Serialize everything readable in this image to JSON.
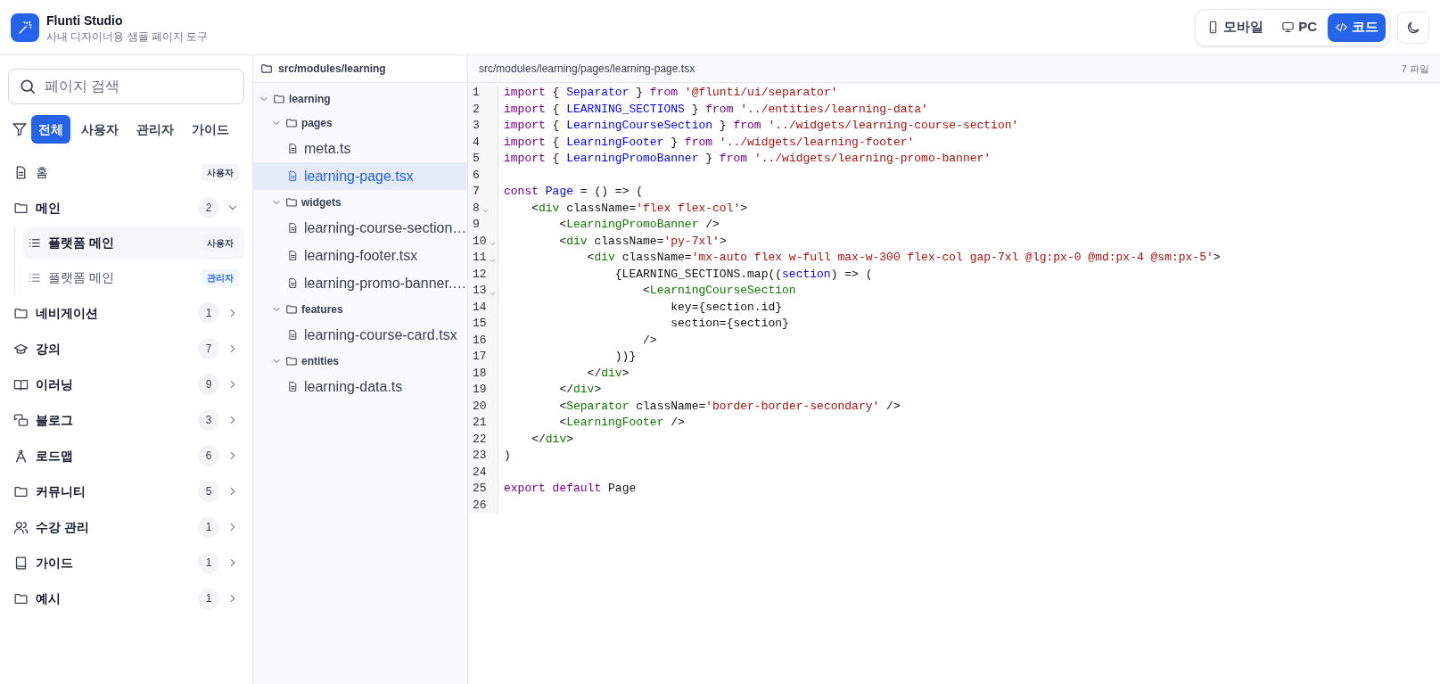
{
  "app": {
    "title": "Flunti Studio",
    "subtitle": "사내 디자이너용 샘플 페이지 도구"
  },
  "view_toggle": [
    {
      "label": "모바일",
      "selected": false
    },
    {
      "label": "PC",
      "selected": false
    },
    {
      "label": "코드",
      "selected": true
    }
  ],
  "sidebar": {
    "search": {
      "placeholder": "페이지 검색"
    },
    "filters": [
      {
        "label": "전체",
        "selected": true
      },
      {
        "label": "사용자",
        "selected": false
      },
      {
        "label": "관리자",
        "selected": false
      },
      {
        "label": "가이드",
        "selected": false
      }
    ],
    "items": [
      {
        "label": "홈",
        "badge": {
          "text": "사용자",
          "kind": "user"
        }
      },
      {
        "label": "메인",
        "count": "2",
        "expanded": true,
        "children": [
          {
            "label": "플랫폼 메인",
            "selected": true,
            "badge": {
              "text": "사용자",
              "kind": "user"
            }
          },
          {
            "label": "플랫폼 메인",
            "selected": false,
            "badge": {
              "text": "관리자",
              "kind": "admin"
            }
          }
        ]
      },
      {
        "label": "네비게이션",
        "count": "1",
        "expanded": false
      },
      {
        "label": "강의",
        "count": "7",
        "expanded": false
      },
      {
        "label": "이러닝",
        "count": "9",
        "expanded": false
      },
      {
        "label": "블로그",
        "count": "3",
        "expanded": false
      },
      {
        "label": "로드맵",
        "count": "6",
        "expanded": false
      },
      {
        "label": "커뮤니티",
        "count": "5",
        "expanded": false
      },
      {
        "label": "수강 관리",
        "count": "1",
        "expanded": false
      },
      {
        "label": "가이드",
        "count": "1",
        "expanded": false
      },
      {
        "label": "예시",
        "count": "1",
        "expanded": false
      }
    ]
  },
  "file_tree": {
    "root": "src/modules/learning",
    "nodes": [
      {
        "kind": "folder",
        "label": "learning",
        "expanded": true,
        "children": [
          {
            "kind": "folder",
            "label": "pages",
            "expanded": true,
            "children": [
              {
                "kind": "file",
                "label": "meta.ts",
                "selected": false
              },
              {
                "kind": "file",
                "label": "learning-page.tsx",
                "selected": true
              }
            ]
          },
          {
            "kind": "folder",
            "label": "widgets",
            "expanded": true,
            "children": [
              {
                "kind": "file",
                "label": "learning-course-section…",
                "selected": false
              },
              {
                "kind": "file",
                "label": "learning-footer.tsx",
                "selected": false
              },
              {
                "kind": "file",
                "label": "learning-promo-banner.…",
                "selected": false
              }
            ]
          },
          {
            "kind": "folder",
            "label": "features",
            "expanded": true,
            "children": [
              {
                "kind": "file",
                "label": "learning-course-card.tsx",
                "selected": false
              }
            ]
          },
          {
            "kind": "folder",
            "label": "entities",
            "expanded": true,
            "children": [
              {
                "kind": "file",
                "label": "learning-data.ts",
                "selected": false
              }
            ]
          }
        ]
      }
    ]
  },
  "editor": {
    "path": "src/modules/learning/pages/learning-page.tsx",
    "file_count": "7 파일",
    "lines": [
      {
        "number": "1",
        "fold": false,
        "tokens": [
          {
            "kind": "keyword",
            "text": "import"
          },
          {
            "kind": "plain",
            "text": " { "
          },
          {
            "kind": "name",
            "text": "Separator"
          },
          {
            "kind": "plain",
            "text": " } "
          },
          {
            "kind": "keyword",
            "text": "from"
          },
          {
            "kind": "string",
            "text": " '@flunti/ui/separator'"
          }
        ]
      },
      {
        "number": "2",
        "fold": false,
        "tokens": [
          {
            "kind": "keyword",
            "text": "import"
          },
          {
            "kind": "plain",
            "text": " { "
          },
          {
            "kind": "name",
            "text": "LEARNING_SECTIONS"
          },
          {
            "kind": "plain",
            "text": " } "
          },
          {
            "kind": "keyword",
            "text": "from"
          },
          {
            "kind": "string",
            "text": " '../entities/learning-data'"
          }
        ]
      },
      {
        "number": "3",
        "fold": false,
        "tokens": [
          {
            "kind": "keyword",
            "text": "import"
          },
          {
            "kind": "plain",
            "text": " { "
          },
          {
            "kind": "name",
            "text": "LearningCourseSection"
          },
          {
            "kind": "plain",
            "text": " } "
          },
          {
            "kind": "keyword",
            "text": "from"
          },
          {
            "kind": "string",
            "text": " '../widgets/learning-course-section'"
          }
        ]
      },
      {
        "number": "4",
        "fold": false,
        "tokens": [
          {
            "kind": "keyword",
            "text": "import"
          },
          {
            "kind": "plain",
            "text": " { "
          },
          {
            "kind": "name",
            "text": "LearningFooter"
          },
          {
            "kind": "plain",
            "text": " } "
          },
          {
            "kind": "keyword",
            "text": "from"
          },
          {
            "kind": "string",
            "text": " '../widgets/learning-footer'"
          }
        ]
      },
      {
        "number": "5",
        "fold": false,
        "tokens": [
          {
            "kind": "keyword",
            "text": "import"
          },
          {
            "kind": "plain",
            "text": " { "
          },
          {
            "kind": "name",
            "text": "LearningPromoBanner"
          },
          {
            "kind": "plain",
            "text": " } "
          },
          {
            "kind": "keyword",
            "text": "from"
          },
          {
            "kind": "string",
            "text": " '../widgets/learning-promo-banner'"
          }
        ]
      },
      {
        "number": "6",
        "fold": false
      },
      {
        "number": "7",
        "fold": false,
        "tokens": [
          {
            "kind": "keyword",
            "text": "const"
          },
          {
            "kind": "name",
            "text": " Page"
          },
          {
            "kind": "plain",
            "text": " = () => ("
          }
        ]
      },
      {
        "number": "8",
        "fold": true,
        "tokens": [
          {
            "kind": "plain",
            "text": "    <"
          },
          {
            "kind": "tag",
            "text": "div"
          },
          {
            "kind": "plain",
            "text": " className="
          },
          {
            "kind": "string",
            "text": "'flex flex-col'"
          },
          {
            "kind": "plain",
            "text": ">"
          }
        ]
      },
      {
        "number": "9",
        "fold": false,
        "tokens": [
          {
            "kind": "plain",
            "text": "        <"
          },
          {
            "kind": "tag",
            "text": "LearningPromoBanner"
          },
          {
            "kind": "plain",
            "text": " />"
          }
        ]
      },
      {
        "number": "10",
        "fold": true,
        "tokens": [
          {
            "kind": "plain",
            "text": "        <"
          },
          {
            "kind": "tag",
            "text": "div"
          },
          {
            "kind": "plain",
            "text": " className="
          },
          {
            "kind": "string",
            "text": "'py-7xl'"
          },
          {
            "kind": "plain",
            "text": ">"
          }
        ]
      },
      {
        "number": "11",
        "fold": true,
        "tokens": [
          {
            "kind": "plain",
            "text": "            <"
          },
          {
            "kind": "tag",
            "text": "div"
          },
          {
            "kind": "plain",
            "text": " className="
          },
          {
            "kind": "string",
            "text": "'mx-auto flex w-full max-w-300 flex-col gap-7xl @lg:px-0 @md:px-4 @sm:px-5'"
          },
          {
            "kind": "plain",
            "text": ">"
          }
        ]
      },
      {
        "number": "12",
        "fold": false,
        "tokens": [
          {
            "kind": "plain",
            "text": "                {LEARNING_SECTIONS.map(("
          },
          {
            "kind": "name",
            "text": "section"
          },
          {
            "kind": "plain",
            "text": ") => ("
          }
        ]
      },
      {
        "number": "13",
        "fold": true,
        "tokens": [
          {
            "kind": "plain",
            "text": "                    <"
          },
          {
            "kind": "tag",
            "text": "LearningCourseSection"
          }
        ]
      },
      {
        "number": "14",
        "fold": false,
        "tokens": [
          {
            "kind": "plain",
            "text": "                        key={section.id}"
          }
        ]
      },
      {
        "number": "15",
        "fold": false,
        "tokens": [
          {
            "kind": "plain",
            "text": "                        section={section}"
          }
        ]
      },
      {
        "number": "16",
        "fold": false,
        "tokens": [
          {
            "kind": "plain",
            "text": "                    />"
          }
        ]
      },
      {
        "number": "17",
        "fold": false,
        "tokens": [
          {
            "kind": "plain",
            "text": "                ))}"
          }
        ]
      },
      {
        "number": "18",
        "fold": false,
        "tokens": [
          {
            "kind": "plain",
            "text": "            </"
          },
          {
            "kind": "tag",
            "text": "div"
          },
          {
            "kind": "plain",
            "text": ">"
          }
        ]
      },
      {
        "number": "19",
        "fold": false,
        "tokens": [
          {
            "kind": "plain",
            "text": "        </"
          },
          {
            "kind": "tag",
            "text": "div"
          },
          {
            "kind": "plain",
            "text": ">"
          }
        ]
      },
      {
        "number": "20",
        "fold": false,
        "tokens": [
          {
            "kind": "plain",
            "text": "        <"
          },
          {
            "kind": "tag",
            "text": "Separator"
          },
          {
            "kind": "plain",
            "text": " className="
          },
          {
            "kind": "string",
            "text": "'border-border-secondary'"
          },
          {
            "kind": "plain",
            "text": " />"
          }
        ]
      },
      {
        "number": "21",
        "fold": false,
        "tokens": [
          {
            "kind": "plain",
            "text": "        <"
          },
          {
            "kind": "tag",
            "text": "LearningFooter"
          },
          {
            "kind": "plain",
            "text": " />"
          }
        ]
      },
      {
        "number": "22",
        "fold": false,
        "tokens": [
          {
            "kind": "plain",
            "text": "    </"
          },
          {
            "kind": "tag",
            "text": "div"
          },
          {
            "kind": "plain",
            "text": ">"
          }
        ]
      },
      {
        "number": "23",
        "fold": false,
        "tokens": [
          {
            "kind": "plain",
            "text": ")"
          }
        ]
      },
      {
        "number": "24",
        "fold": false
      },
      {
        "number": "25",
        "fold": false,
        "tokens": [
          {
            "kind": "keyword",
            "text": "export"
          },
          {
            "kind": "keyword",
            "text": " default"
          },
          {
            "kind": "plain",
            "text": " Page"
          }
        ]
      },
      {
        "number": "26",
        "fold": false
      }
    ]
  }
}
